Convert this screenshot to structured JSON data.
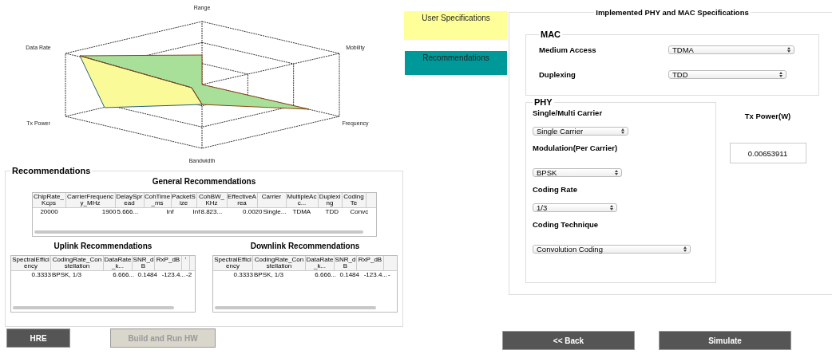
{
  "radar": {
    "axes": [
      "Range",
      "Mobility",
      "Frequency",
      "Bandwidth",
      "Tx Power",
      "Data Rate"
    ]
  },
  "legend": [
    {
      "label": "User Specifications",
      "color": "#ffff99"
    },
    {
      "label": "Recommendations",
      "color": "#009999"
    }
  ],
  "recommendations": {
    "title": "Recommendations",
    "general": {
      "title": "General Recommendations",
      "columns": [
        "ChipRate_Kcps",
        "CarrierFrequency_MHz",
        "DelaySpread",
        "CohTime_ms",
        "PacketSize",
        "CohBW_KHz",
        "EffectiveArea",
        "Carrier",
        "MultipleAcc...",
        "Duplexing",
        "CodingTe"
      ],
      "rows": [
        [
          "20000",
          "1900",
          "5.666...",
          "Inf",
          "Inf",
          "8.823...",
          "0.0020",
          "Single...",
          "TDMA",
          "TDD",
          "Convc"
        ]
      ]
    },
    "uplink": {
      "title": "Uplink Recommendations",
      "columns": [
        "SpectralEfficiency",
        "CodingRate_Constellation",
        "DataRate_k...",
        "SNR_dB",
        "RxP_dB",
        "'"
      ],
      "rows": [
        [
          "0.3333",
          "BPSK, 1/3",
          "6.666...",
          "0.1484",
          "-123.4...",
          "-2"
        ]
      ]
    },
    "downlink": {
      "title": "Downlink Recommendations",
      "columns": [
        "SpectralEfficiency",
        "CodingRate_Constellation",
        "DataRate_k...",
        "SNR_dB",
        "RxP_dB"
      ],
      "rows": [
        [
          "0.3333",
          "BPSK, 1/3",
          "6.666...",
          "0.1484",
          "-123.4...",
          "-"
        ]
      ]
    }
  },
  "bottom_buttons": [
    {
      "label": "HRE",
      "disabled": false
    },
    {
      "label": "Build and Run HW",
      "disabled": true
    }
  ],
  "specs": {
    "title": "Implemented PHY and MAC Specifications",
    "mac": {
      "title": "MAC",
      "fields": [
        {
          "label": "Medium Access",
          "value": "TDMA"
        },
        {
          "label": "Duplexing",
          "value": "TDD"
        }
      ]
    },
    "phy": {
      "title": "PHY",
      "fields": [
        {
          "label": "Single/Multi Carrier",
          "value": "Single Carrier"
        },
        {
          "label": "Modulation(Per Carrier)",
          "value": "BPSK"
        },
        {
          "label": "Coding Rate",
          "value": "1/3"
        },
        {
          "label": "Coding Technique",
          "value": "Convolution Coding"
        }
      ]
    },
    "tx_power": {
      "label": "Tx Power(W)",
      "value": "0.00653911"
    }
  },
  "action_buttons": [
    "<< Back",
    "Simulate"
  ]
}
